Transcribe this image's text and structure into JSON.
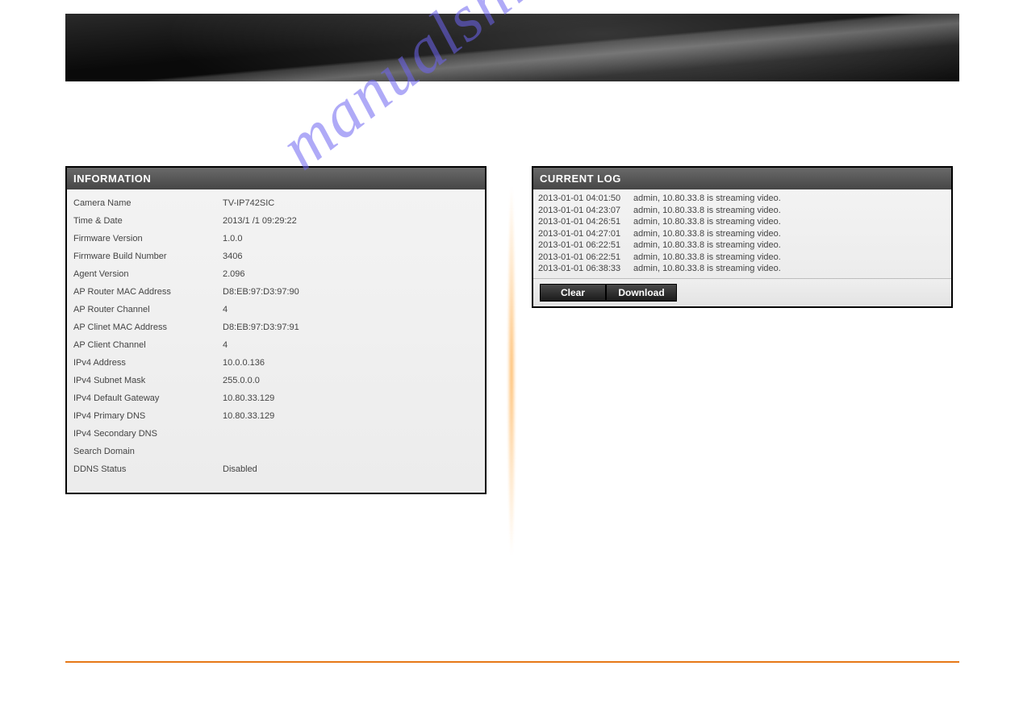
{
  "watermark": "manualshive.  m",
  "info": {
    "header": "INFORMATION",
    "rows": [
      {
        "label": "Camera Name",
        "value": "TV-IP742SIC"
      },
      {
        "label": "Time & Date",
        "value": "2013/1 /1 09:29:22"
      },
      {
        "label": "Firmware Version",
        "value": "1.0.0"
      },
      {
        "label": "Firmware Build Number",
        "value": "3406"
      },
      {
        "label": "Agent Version",
        "value": "2.096"
      },
      {
        "label": "AP Router MAC Address",
        "value": "D8:EB:97:D3:97:90"
      },
      {
        "label": "AP Router Channel",
        "value": "4"
      },
      {
        "label": "AP Clinet MAC Address",
        "value": "D8:EB:97:D3:97:91"
      },
      {
        "label": "AP Client Channel",
        "value": "4"
      },
      {
        "label": "IPv4 Address",
        "value": "10.0.0.136"
      },
      {
        "label": "IPv4 Subnet Mask",
        "value": "255.0.0.0"
      },
      {
        "label": "IPv4 Default Gateway",
        "value": "10.80.33.129"
      },
      {
        "label": "IPv4 Primary DNS",
        "value": "10.80.33.129"
      },
      {
        "label": "IPv4 Secondary DNS",
        "value": ""
      },
      {
        "label": "Search Domain",
        "value": ""
      },
      {
        "label": "DDNS Status",
        "value": "Disabled"
      }
    ]
  },
  "log": {
    "header": "CURRENT LOG",
    "entries": [
      {
        "ts": "2013-01-01 04:01:50",
        "msg": "admin, 10.80.33.8 is streaming video."
      },
      {
        "ts": "2013-01-01 04:23:07",
        "msg": "admin, 10.80.33.8 is streaming video."
      },
      {
        "ts": "2013-01-01 04:26:51",
        "msg": "admin, 10.80.33.8 is streaming video."
      },
      {
        "ts": "2013-01-01 04:27:01",
        "msg": "admin, 10.80.33.8 is streaming video."
      },
      {
        "ts": "2013-01-01 06:22:51",
        "msg": "admin, 10.80.33.8 is streaming video."
      },
      {
        "ts": "2013-01-01 06:22:51",
        "msg": "admin, 10.80.33.8 is streaming video."
      },
      {
        "ts": "2013-01-01 06:38:33",
        "msg": "admin, 10.80.33.8 is streaming video."
      }
    ],
    "buttons": {
      "clear": "Clear",
      "download": "Download"
    }
  }
}
